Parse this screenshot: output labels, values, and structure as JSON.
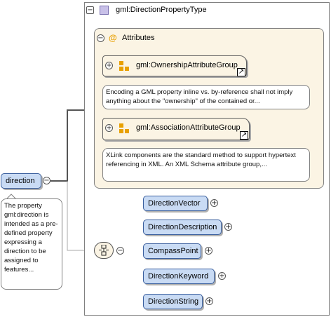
{
  "type": {
    "name": "gml:DirectionPropertyType"
  },
  "attributes": {
    "label": "Attributes",
    "at_symbol": "@"
  },
  "attribute_groups": [
    {
      "name": "gml:OwnershipAttributeGroup",
      "doc": "Encoding a GML property inline vs. by-reference shall not imply anything about the \"ownership\" of the contained or..."
    },
    {
      "name": "gml:AssociationAttributeGroup",
      "doc": "XLink components are the standard method to support hypertext referencing in XML. An XML Schema attribute group,..."
    }
  ],
  "element": {
    "name": "direction",
    "doc": "The property gml:direction is intended as a pre-defined property expressing a direction to be assigned to features..."
  },
  "choices": [
    {
      "name": "DirectionVector"
    },
    {
      "name": "DirectionDescription"
    },
    {
      "name": "CompassPoint"
    },
    {
      "name": "DirectionKeyword"
    },
    {
      "name": "DirectionString"
    }
  ],
  "symbols": {
    "collapse": "−",
    "expand": "+",
    "link_arrow": "↗"
  },
  "colors": {
    "element_fill": "#c9dbf4",
    "element_border": "#3a5f9e",
    "attribute_fill": "#fbf4e4",
    "icon_orange": "#e8a000",
    "type_icon": "#c8c0e8"
  }
}
